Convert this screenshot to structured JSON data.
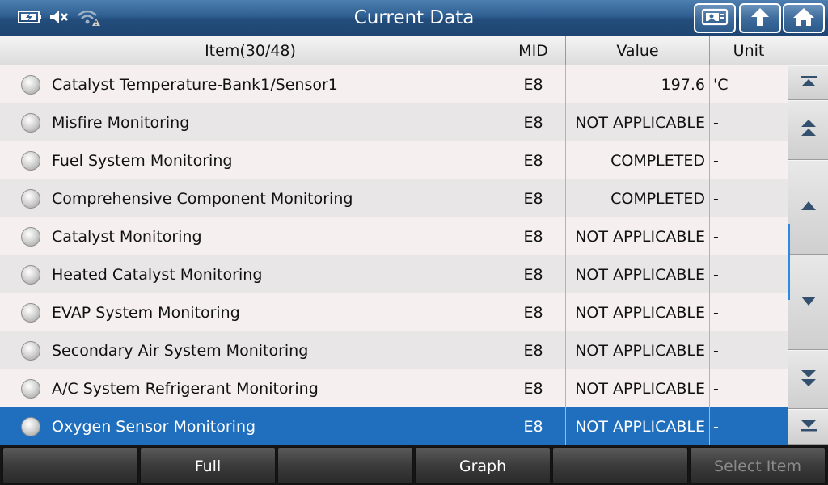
{
  "header": {
    "title": "Current Data",
    "status_icons": [
      "battery-icon",
      "speaker-muted-icon",
      "wifi-warning-icon"
    ],
    "buttons": [
      "print-icon",
      "back-icon",
      "home-icon"
    ]
  },
  "table": {
    "columns": {
      "item": "Item(30/48)",
      "mid": "MID",
      "value": "Value",
      "unit": "Unit"
    },
    "rows": [
      {
        "item": "Catalyst Temperature-Bank1/Sensor1",
        "mid": "E8",
        "value": "197.6",
        "unit": "'C"
      },
      {
        "item": "Misfire Monitoring",
        "mid": "E8",
        "value": "NOT APPLICABLE",
        "unit": "-"
      },
      {
        "item": "Fuel System Monitoring",
        "mid": "E8",
        "value": "COMPLETED",
        "unit": "-"
      },
      {
        "item": "Comprehensive Component Monitoring",
        "mid": "E8",
        "value": "COMPLETED",
        "unit": "-"
      },
      {
        "item": "Catalyst Monitoring",
        "mid": "E8",
        "value": "NOT APPLICABLE",
        "unit": "-"
      },
      {
        "item": "Heated Catalyst Monitoring",
        "mid": "E8",
        "value": "NOT APPLICABLE",
        "unit": "-"
      },
      {
        "item": "EVAP System Monitoring",
        "mid": "E8",
        "value": "NOT APPLICABLE",
        "unit": "-"
      },
      {
        "item": "Secondary Air System Monitoring",
        "mid": "E8",
        "value": "NOT APPLICABLE",
        "unit": "-"
      },
      {
        "item": "A/C System Refrigerant Monitoring",
        "mid": "E8",
        "value": "NOT APPLICABLE",
        "unit": "-"
      },
      {
        "item": "Oxygen Sensor Monitoring",
        "mid": "E8",
        "value": "NOT APPLICABLE",
        "unit": "-"
      }
    ],
    "selected_row": 9
  },
  "scroll": {
    "buttons": [
      "scroll-top-icon",
      "page-up-icon",
      "line-up-icon",
      "line-down-icon",
      "page-down-icon",
      "scroll-bottom-icon"
    ],
    "accent_color": "#2a8be0"
  },
  "footer": {
    "buttons": [
      "",
      "Full",
      "",
      "Graph",
      "",
      "Select Item"
    ]
  },
  "colors": {
    "header_blue": "#2f5f92",
    "selection_blue": "#1f6fbe"
  }
}
